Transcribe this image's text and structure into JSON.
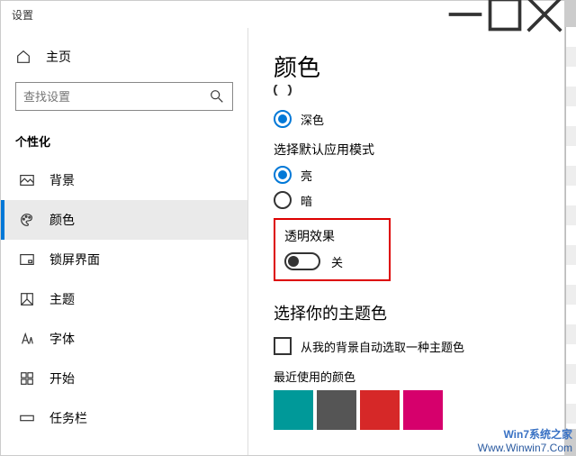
{
  "window": {
    "title": "设置"
  },
  "sidebar": {
    "home": "主页",
    "search_placeholder": "查找设置",
    "category": "个性化",
    "items": [
      {
        "label": "背景"
      },
      {
        "label": "颜色"
      },
      {
        "label": "锁屏界面"
      },
      {
        "label": "主题"
      },
      {
        "label": "字体"
      },
      {
        "label": "开始"
      },
      {
        "label": "任务栏"
      }
    ]
  },
  "content": {
    "title": "颜色",
    "mode_dark": "深色",
    "app_mode_label": "选择默认应用模式",
    "app_mode_light": "亮",
    "app_mode_dark": "暗",
    "transparency_label": "透明效果",
    "transparency_state": "关",
    "accent_heading": "选择你的主题色",
    "auto_pick": "从我的背景自动选取一种主题色",
    "recent_label": "最近使用的颜色",
    "swatches": [
      "#009999",
      "#555555",
      "#d62828",
      "#d6006c"
    ]
  },
  "watermark": {
    "line1": "Win7系统之家",
    "line2": "Www.Winwin7.Com"
  }
}
